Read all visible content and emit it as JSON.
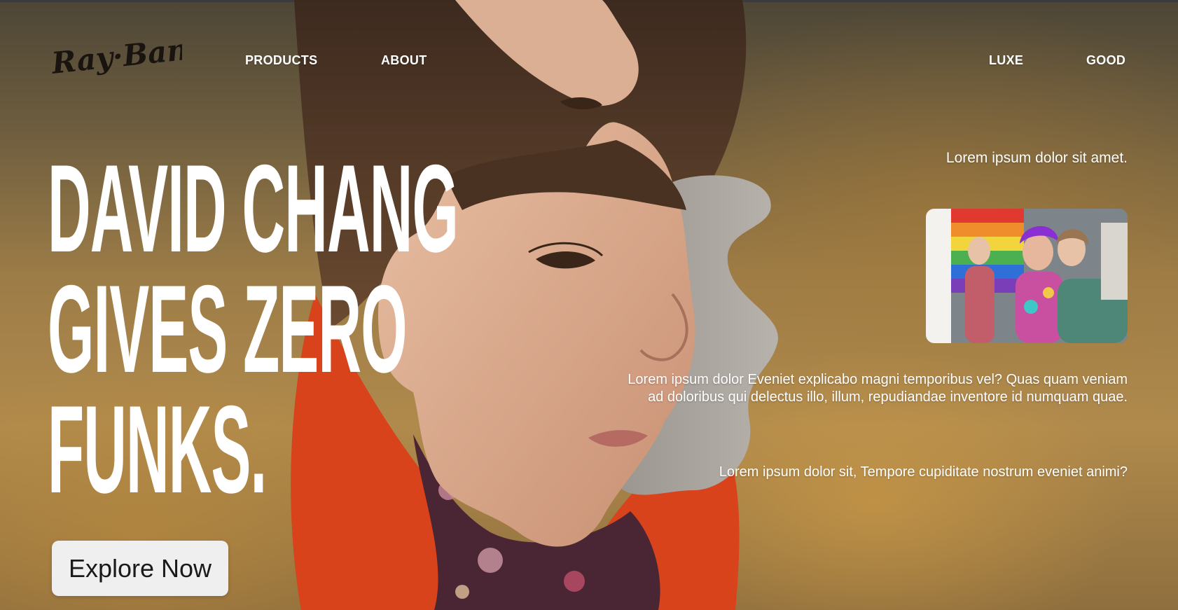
{
  "header": {
    "logo_text": "Ray·Ban®",
    "nav_left": [
      "PRODUCTS",
      "ABOUT"
    ],
    "nav_right": [
      "LUXE",
      "GOOD"
    ]
  },
  "hero": {
    "headline_lines": [
      "DAVID CHANG",
      "GIVES ZERO",
      "FUNKS."
    ],
    "cta_label": "Explore Now",
    "tagline": "Lorem ipsum dolor sit amet.",
    "paragraph_1": "Lorem ipsum dolor Eveniet explicabo magni temporibus vel? Quas quam veniam ad doloribus qui delectus illo, illum, repudiandae inventore id numquam quae.",
    "paragraph_2": "Lorem ipsum dolor sit, Tempore cupiditate nostrum eveniet animi?"
  },
  "colors": {
    "text": "#ffffff",
    "cta_background": "#efefef",
    "cta_text": "#1a1a1a",
    "jacket_red": "#d8431c"
  }
}
